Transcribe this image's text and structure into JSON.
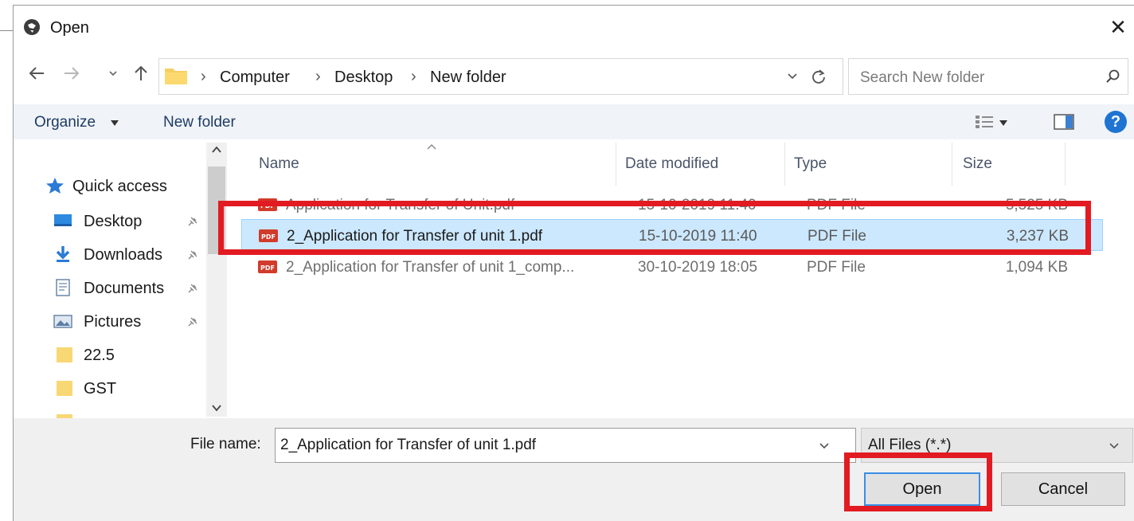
{
  "window": {
    "title": "Open",
    "close_glyph": "✕"
  },
  "address": {
    "crumbs": [
      "Computer",
      "Desktop",
      "New folder"
    ],
    "search_placeholder": "Search New folder"
  },
  "toolbar": {
    "organize_label": "Organize",
    "new_folder_label": "New folder",
    "help_glyph": "?"
  },
  "nav": {
    "items": [
      {
        "label": "Quick access",
        "icon": "star-icon"
      },
      {
        "label": "Desktop",
        "icon": "desktop-icon",
        "pinned": true
      },
      {
        "label": "Downloads",
        "icon": "download-arrow-icon",
        "pinned": true
      },
      {
        "label": "Documents",
        "icon": "documents-icon",
        "pinned": true
      },
      {
        "label": "Pictures",
        "icon": "pictures-icon",
        "pinned": true
      },
      {
        "label": "22.5",
        "icon": "folder-icon"
      },
      {
        "label": "GST",
        "icon": "folder-icon"
      }
    ]
  },
  "columns": {
    "name": "Name",
    "date": "Date modified",
    "type": "Type",
    "size": "Size"
  },
  "files": [
    {
      "name": "Application for Transfer of Unit.pdf",
      "date": "15-10-2019 11:40",
      "type": "PDF File",
      "size": "5,525 KB"
    },
    {
      "name": "2_Application for Transfer of unit 1.pdf",
      "date": "15-10-2019 11:40",
      "type": "PDF File",
      "size": "3,237 KB"
    },
    {
      "name": "2_Application for Transfer of unit 1_comp...",
      "date": "30-10-2019 18:05",
      "type": "PDF File",
      "size": "1,094 KB"
    }
  ],
  "file_icon_text": "PDF",
  "bottom": {
    "filename_label": "File name:",
    "filename_value": "2_Application for Transfer of unit 1.pdf",
    "filter_value": "All Files (*.*)",
    "open_label": "Open",
    "cancel_label": "Cancel"
  },
  "colors": {
    "selection": "#cce8ff",
    "highlight": "#e21b22",
    "accent": "#1f74d1"
  }
}
